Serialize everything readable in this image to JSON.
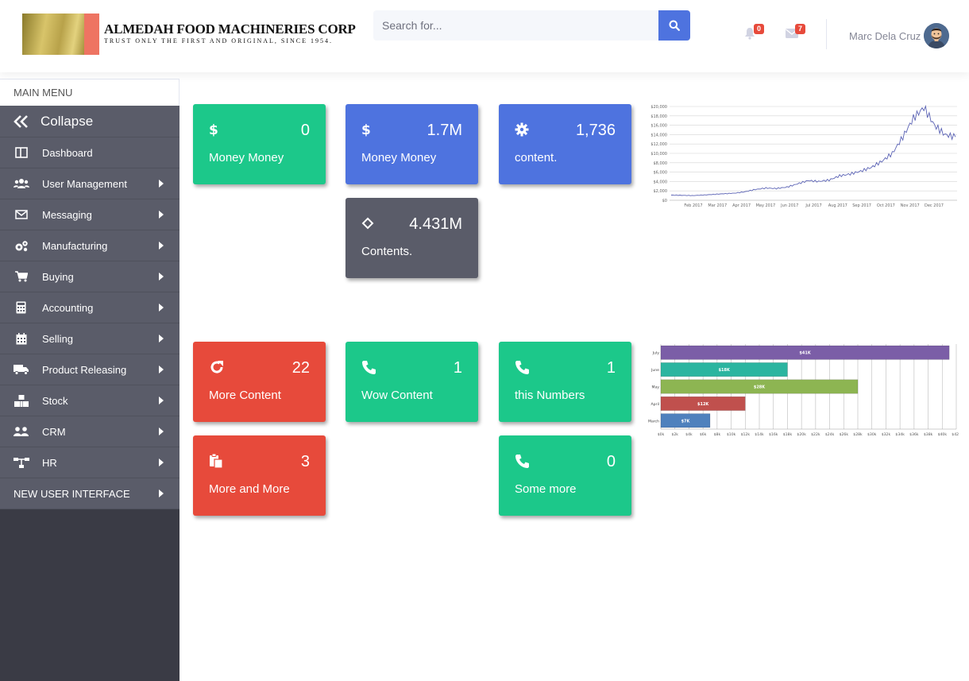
{
  "header": {
    "company_name": "ALMEDAH FOOD MACHINERIES CORP",
    "tagline": "TRUST ONLY THE FIRST AND ORIGINAL, SINCE 1954.",
    "search_placeholder": "Search for...",
    "alerts_count": "0",
    "messages_count": "7",
    "user_name": "Marc Dela Cruz"
  },
  "sidebar": {
    "menu_header": "MAIN MENU",
    "collapse_label": "Collapse",
    "items": [
      {
        "label": "Dashboard",
        "icon": "dashboard-icon"
      },
      {
        "label": "User Management",
        "icon": "users-icon"
      },
      {
        "label": "Messaging",
        "icon": "envelope-icon"
      },
      {
        "label": "Manufacturing",
        "icon": "cogs-icon"
      },
      {
        "label": "Buying",
        "icon": "cart-icon"
      },
      {
        "label": "Accounting",
        "icon": "calculator-icon"
      },
      {
        "label": "Selling",
        "icon": "calendar-icon"
      },
      {
        "label": "Product Releasing",
        "icon": "truck-icon"
      },
      {
        "label": "Stock",
        "icon": "cubes-icon"
      },
      {
        "label": "CRM",
        "icon": "people-icon"
      },
      {
        "label": "HR",
        "icon": "sitemap-icon"
      }
    ],
    "new_ui_label": "NEW USER INTERFACE"
  },
  "cards": [
    {
      "value": "0",
      "label": "Money Money",
      "icon": "dollar-icon",
      "color": "#1cc88a"
    },
    {
      "value": "1.7M",
      "label": "Money Money",
      "icon": "dollar-icon",
      "color": "#4e73df"
    },
    {
      "value": "1,736",
      "label": "content.",
      "icon": "gear-icon",
      "color": "#4e73df"
    },
    {
      "value": "4.431M",
      "label": "Contents.",
      "icon": "diamond-icon",
      "color": "#5a5c69"
    },
    {
      "value": "22",
      "label": "More Content",
      "icon": "refresh-icon",
      "color": "#e74a3b"
    },
    {
      "value": "1",
      "label": "Wow Content",
      "icon": "phone-icon",
      "color": "#1cc88a"
    },
    {
      "value": "1",
      "label": "this Numbers",
      "icon": "phone-icon",
      "color": "#1cc88a"
    },
    {
      "value": "3",
      "label": "More and More",
      "icon": "clipboard-icon",
      "color": "#e74a3b"
    },
    {
      "value": "0",
      "label": "Some more",
      "icon": "phone-icon",
      "color": "#1cc88a"
    }
  ],
  "chart_data": [
    {
      "type": "line",
      "title": "",
      "x": [
        "Feb 2017",
        "Mar 2017",
        "Apr 2017",
        "May 2017",
        "Jun 2017",
        "Jul 2017",
        "Aug 2017",
        "Sep 2017",
        "Oct 2017",
        "Nov 2017",
        "Dec 2017"
      ],
      "y_ticks": [
        "$0",
        "$2,000",
        "$4,000",
        "$6,000",
        "$8,000",
        "$10,000",
        "$12,000",
        "$14,000",
        "$16,000",
        "$18,000",
        "$20,000"
      ],
      "ylim": [
        0,
        20000
      ],
      "series": [
        {
          "values": [
            1100,
            1050,
            1000,
            1100,
            1250,
            1400,
            1500,
            1800,
            2300,
            2600,
            2500,
            2800,
            3500,
            4200,
            4000,
            4300,
            5200,
            5600,
            6200,
            7000,
            8300,
            10000,
            13500,
            17500,
            19800,
            16000,
            14000,
            13500
          ]
        }
      ],
      "color": "#5b63b5",
      "grid": true
    },
    {
      "type": "bar",
      "orientation": "horizontal",
      "categories": [
        "July",
        "June",
        "May",
        "April",
        "March"
      ],
      "values": [
        41,
        18,
        28,
        12,
        7
      ],
      "data_labels": [
        "$41K",
        "$18K",
        "$28K",
        "$12K",
        "$7K"
      ],
      "colors": [
        "#7b5ea7",
        "#2bb5a0",
        "#8db552",
        "#c0504d",
        "#4f81bd"
      ],
      "x_ticks": [
        "$0k",
        "$2k",
        "$4k",
        "$6k",
        "$8k",
        "$10k",
        "$12k",
        "$14k",
        "$16k",
        "$18k",
        "$20k",
        "$22k",
        "$24k",
        "$26k",
        "$28k",
        "$30k",
        "$32k",
        "$34k",
        "$36k",
        "$38k",
        "$40k",
        "$42k"
      ],
      "xlim": [
        0,
        42
      ],
      "grid": true
    }
  ]
}
